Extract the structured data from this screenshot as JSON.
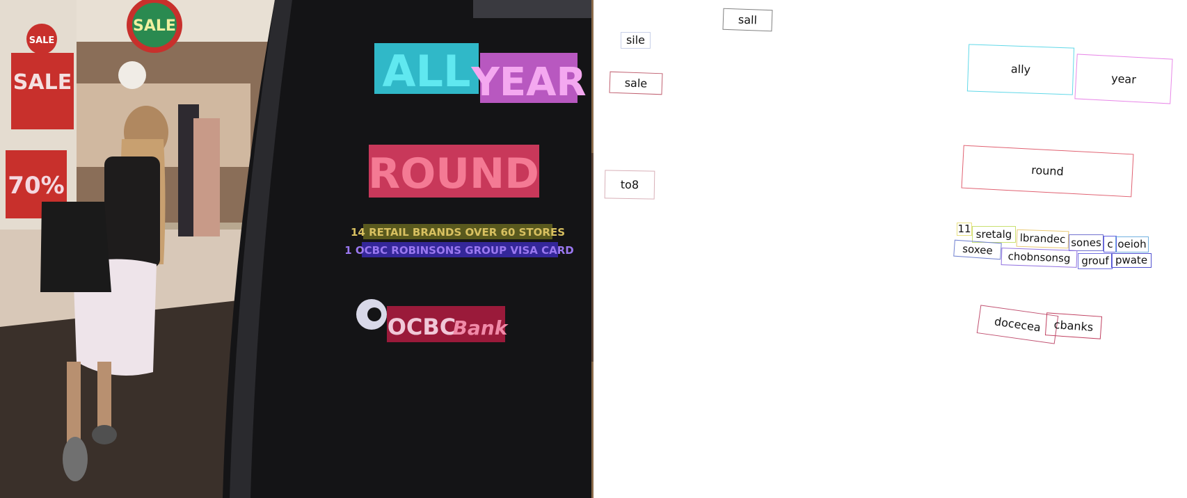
{
  "photo": {
    "sale_signs": [
      "SALE",
      "SALE",
      "SALE"
    ],
    "discount": "70%",
    "pillar": {
      "line1a": "ALL",
      "line1b": "YEAR",
      "line2": "ROUND",
      "retail_line1": "14 RETAIL BRANDS OVER 60 STORES",
      "retail_line2": "1 OCBC ROBINSONS GROUP VISA CARD",
      "bank_name": "OCBC",
      "bank_suffix": "Bank"
    }
  },
  "detections": [
    {
      "text": "sall",
      "color": "#808080"
    },
    {
      "text": "sile",
      "color": "#c8d0e8"
    },
    {
      "text": "sale",
      "color": "#c06070"
    },
    {
      "text": "to8",
      "color": "#d8b0b8"
    },
    {
      "text": "ally",
      "color": "#60d8e8"
    },
    {
      "text": "year",
      "color": "#e888e8"
    },
    {
      "text": "round",
      "color": "#e06070"
    },
    {
      "text": "11",
      "color": "#e8e080"
    },
    {
      "text": "sretalg",
      "color": "#c8e070"
    },
    {
      "text": "lbrandec",
      "color": "#e8c870"
    },
    {
      "text": "sones",
      "color": "#7070d0"
    },
    {
      "text": "c",
      "color": "#6060e0"
    },
    {
      "text": "oeioh",
      "color": "#70b0e0"
    },
    {
      "text": "soxee",
      "color": "#7080d0"
    },
    {
      "text": "chobnsonsg",
      "color": "#9070e0"
    },
    {
      "text": "grouf",
      "color": "#7070e0"
    },
    {
      "text": "pwate",
      "color": "#5050d0"
    },
    {
      "text": "docecea",
      "color": "#c05070"
    },
    {
      "text": "cbanks",
      "color": "#c04060"
    }
  ]
}
